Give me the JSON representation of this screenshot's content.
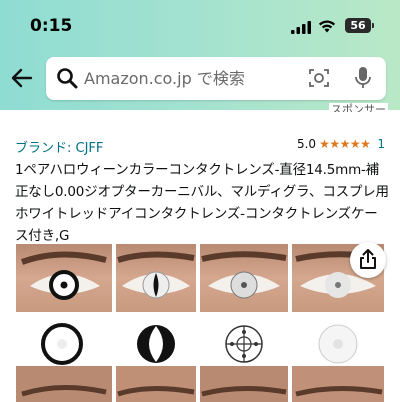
{
  "status_bar": {
    "time": "0:15",
    "battery": "56"
  },
  "search": {
    "placeholder": "Amazon.co.jp で検索"
  },
  "sponsor_label": "スポンサー",
  "product": {
    "brand": "ブランド: CJFF",
    "rating": "5.0",
    "stars": "★★★★★",
    "review_count": "1",
    "title": "1ペアハロウィーンカラーコンタクトレンズ-直径14.5mm-補正なし0.00ジオプターカーニバル、マルディグラ、コスプレ用ホワイトレッドアイコンタクトレンズ-コンタクトレンズケース付き,G"
  },
  "colors": {
    "link": "#007185",
    "star": "#de7921",
    "header_gradient_start": "#8fdcd3",
    "header_gradient_end": "#b9e8c6"
  },
  "icons": [
    "back-arrow-icon",
    "search-icon",
    "camera-scan-icon",
    "microphone-icon",
    "share-icon",
    "signal-icon",
    "wifi-icon",
    "battery-icon"
  ],
  "gallery": {
    "variants": [
      "black-ring-lens",
      "cat-eye-lens",
      "crosshair-lens",
      "white-lens"
    ]
  }
}
